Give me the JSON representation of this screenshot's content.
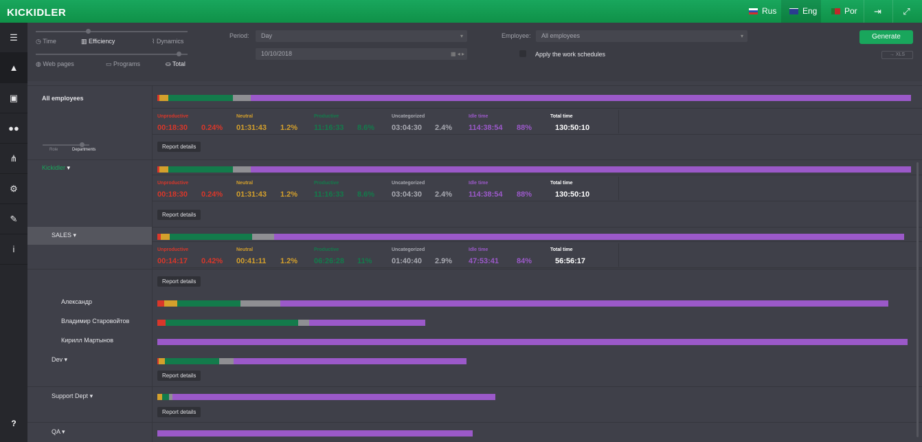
{
  "app": {
    "logo": "KICKIDLER"
  },
  "langs": [
    {
      "label": "Rus",
      "color": "#d0312d"
    },
    {
      "label": "Eng",
      "color": "#2a3c8f"
    },
    {
      "label": "Por",
      "color": "#c0282b"
    }
  ],
  "controls": {
    "mode1": [
      "Time",
      "Efficiency",
      "Dynamics"
    ],
    "mode2": [
      "Web pages",
      "Programs",
      "Total"
    ],
    "period_label": "Period:",
    "period_value": "Day",
    "date_value": "10/10/2018",
    "employee_label": "Employee:",
    "employee_value": "All employees",
    "schedule_label": "Apply the work schedules",
    "generate": "Generate",
    "xls": "→ XLS"
  },
  "toggle": {
    "left": "Role",
    "right": "Departments"
  },
  "stat_labels": {
    "unproductive": "Unproductive",
    "neutral": "Neutral",
    "productive": "Productive",
    "uncategorized": "Uncategorized",
    "idle": "Idle time",
    "total": "Total time"
  },
  "colors": {
    "unproductive": "#d9372a",
    "neutral": "#d4a02c",
    "productive": "#137b4b",
    "uncategorized": "#8f8f93",
    "idle": "#9b59c9",
    "total": "#ffffff"
  },
  "groups": [
    {
      "name": "All employees",
      "stats": {
        "unproductive": [
          "00:18:30",
          "0.24%"
        ],
        "neutral": [
          "01:31:43",
          "1.2%"
        ],
        "productive": [
          "11:16:33",
          "8.6%"
        ],
        "uncategorized": [
          "03:04:30",
          "2.4%"
        ],
        "idle": [
          "114:38:54",
          "88%"
        ],
        "total": "130:50:10"
      },
      "bar": [
        0.24,
        1.2,
        8.6,
        2.4,
        88
      ]
    },
    {
      "name": "Kickidler",
      "stats": {
        "unproductive": [
          "00:18:30",
          "0.24%"
        ],
        "neutral": [
          "01:31:43",
          "1.2%"
        ],
        "productive": [
          "11:16:33",
          "8.6%"
        ],
        "uncategorized": [
          "03:04:30",
          "2.4%"
        ],
        "idle": [
          "114:38:54",
          "88%"
        ],
        "total": "130:50:10"
      },
      "bar": [
        0.24,
        1.2,
        8.6,
        2.4,
        88
      ]
    },
    {
      "name": "SALES",
      "stats": {
        "unproductive": [
          "00:14:17",
          "0.42%"
        ],
        "neutral": [
          "00:41:11",
          "1.2%"
        ],
        "productive": [
          "06:26:28",
          "11%"
        ],
        "uncategorized": [
          "01:40:40",
          "2.9%"
        ],
        "idle": [
          "47:53:41",
          "84%"
        ],
        "total": "56:56:17"
      },
      "bar": [
        0.42,
        1.2,
        11,
        2.9,
        84
      ]
    }
  ],
  "report_details": "Report details",
  "employees": [
    {
      "name": "Александр",
      "bar": [
        0.9,
        1.7,
        8.4,
        5.3,
        81.0
      ]
    },
    {
      "name": "Владимир Старовойтов",
      "bar": [
        1.1,
        0,
        17.7,
        1.5,
        15.5
      ]
    },
    {
      "name": "Кирилл Мартынов",
      "bar": [
        0,
        0,
        0,
        0,
        100
      ]
    }
  ],
  "departments": [
    {
      "name": "Dev",
      "bar": [
        0.2,
        0.8,
        7.2,
        1.9,
        31
      ]
    },
    {
      "name": "Support Dept",
      "bar": [
        0,
        0.6,
        0.9,
        0.5,
        43
      ]
    },
    {
      "name": "QA",
      "bar": [
        0,
        0,
        0,
        0,
        42
      ]
    }
  ]
}
